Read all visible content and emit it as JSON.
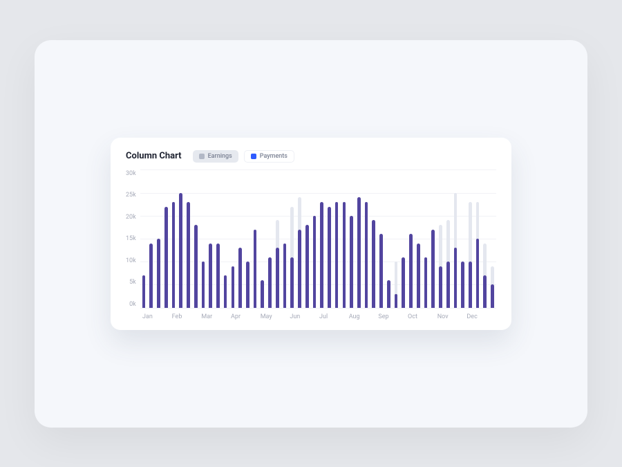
{
  "title": "Column Chart",
  "legend": {
    "earnings": "Earnings",
    "payments": "Payments"
  },
  "y_ticks": [
    "30k",
    "25k",
    "20k",
    "15k",
    "10k",
    "5k",
    "0k"
  ],
  "x_ticks": [
    "Jan",
    "Feb",
    "Mar",
    "Apr",
    "May",
    "Jun",
    "Jul",
    "Aug",
    "Sep",
    "Oct",
    "Nov",
    "Dec"
  ],
  "chart_data": {
    "type": "bar",
    "title": "Column Chart",
    "ylabel": "",
    "xlabel": "",
    "ylim": [
      0,
      30
    ],
    "y_unit": "k",
    "categories_per_month": 4,
    "months": [
      "Jan",
      "Feb",
      "Mar",
      "Apr",
      "May",
      "Jun",
      "Jul",
      "Aug",
      "Sep",
      "Oct",
      "Nov",
      "Dec"
    ],
    "series": [
      {
        "name": "Earnings",
        "color": "#e4e7ef",
        "values": [
          7,
          14,
          15,
          22,
          23,
          25,
          23,
          18,
          10,
          14,
          14,
          7,
          9,
          13,
          10,
          17,
          6,
          11,
          19,
          14,
          22,
          24,
          18,
          20,
          23,
          22,
          23,
          23,
          20,
          24,
          23,
          19,
          16,
          6,
          10,
          11,
          16,
          14,
          11,
          17,
          18,
          19,
          25,
          10,
          23,
          23,
          14,
          9
        ]
      },
      {
        "name": "Payments",
        "color": "#52459f",
        "values": [
          7,
          14,
          15,
          22,
          23,
          25,
          23,
          18,
          10,
          14,
          14,
          7,
          9,
          13,
          10,
          17,
          6,
          11,
          13,
          14,
          11,
          17,
          18,
          20,
          23,
          22,
          23,
          23,
          20,
          24,
          23,
          19,
          16,
          6,
          3,
          11,
          16,
          14,
          11,
          17,
          9,
          10,
          13,
          10,
          10,
          15,
          7,
          5
        ]
      }
    ]
  }
}
